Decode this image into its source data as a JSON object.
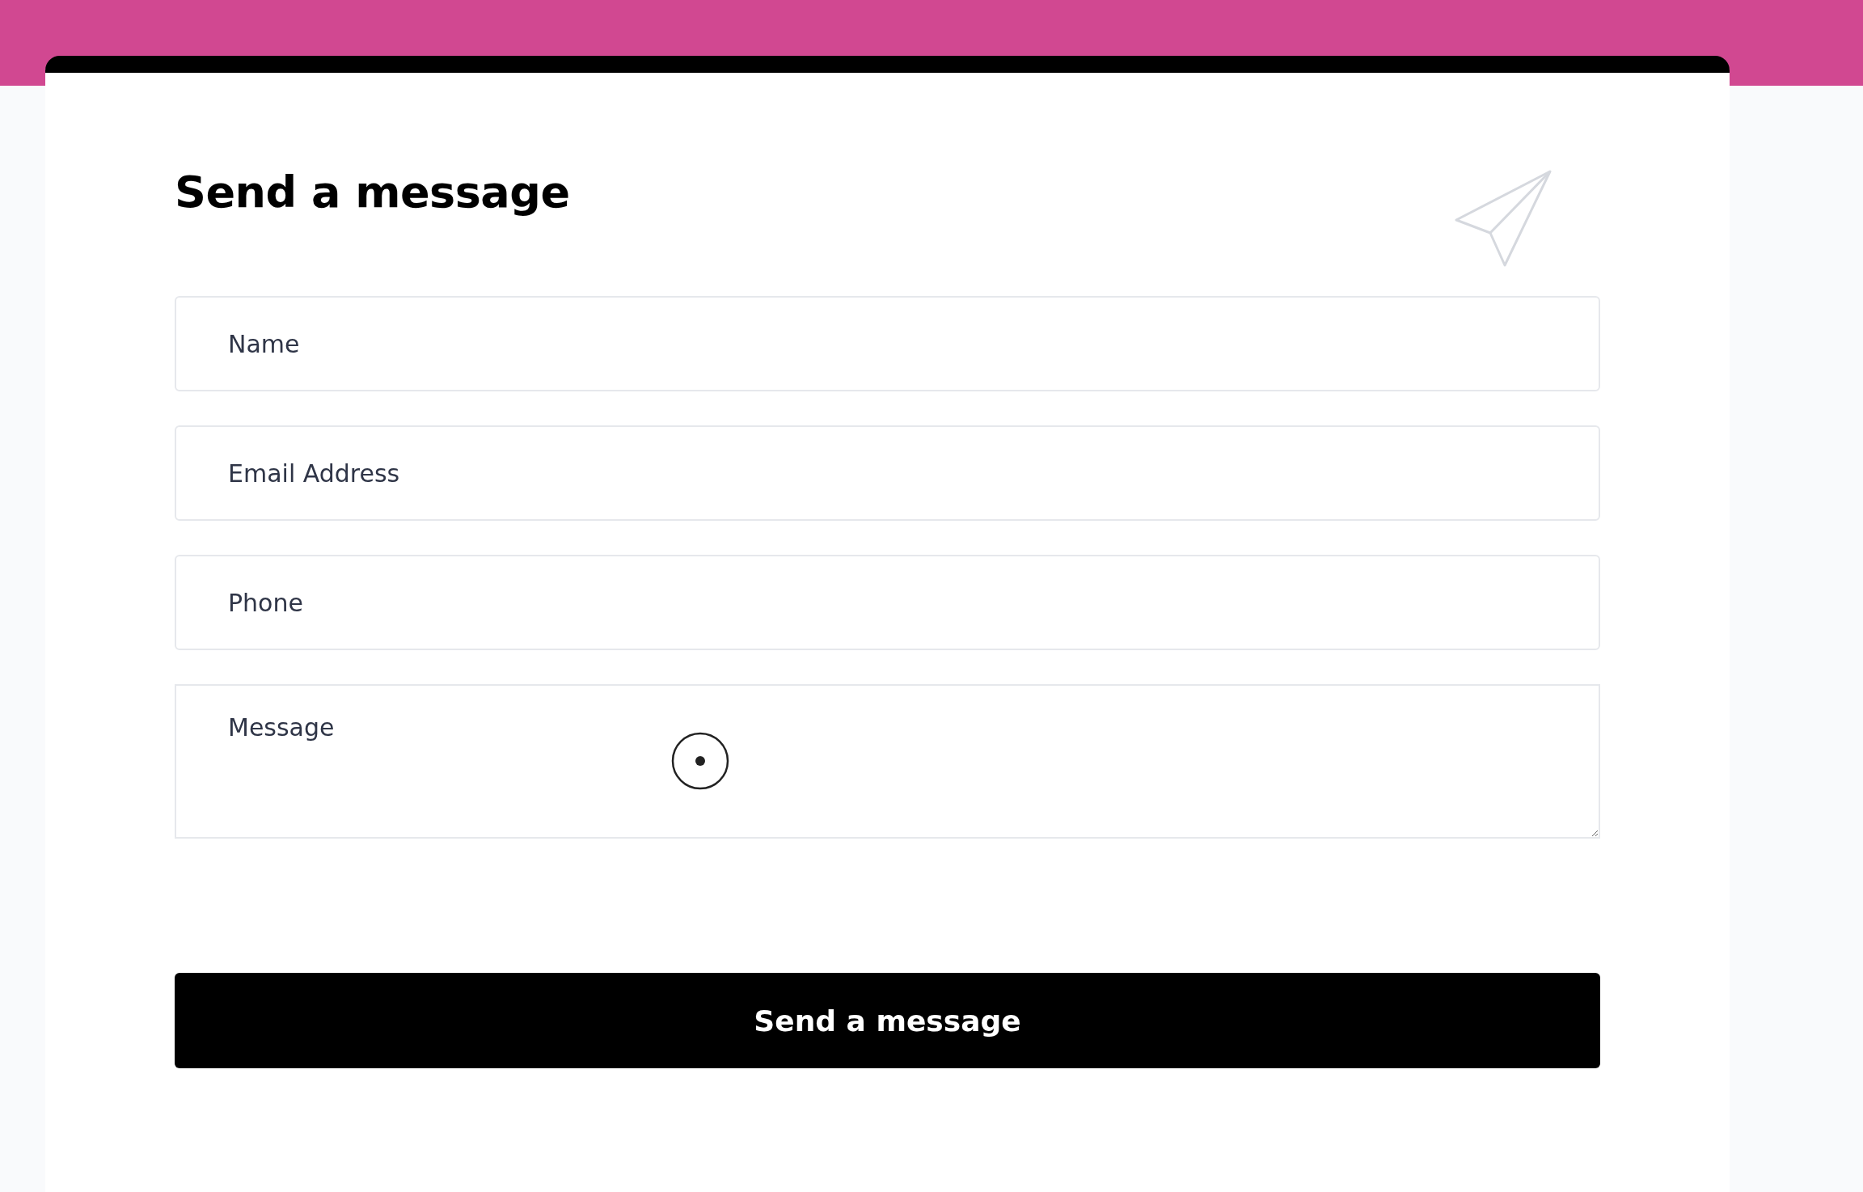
{
  "form": {
    "title": "Send a message",
    "fields": [
      {
        "kind": "input",
        "placeholder": "Name"
      },
      {
        "kind": "input",
        "placeholder": "Email Address"
      },
      {
        "kind": "input",
        "placeholder": "Phone"
      },
      {
        "kind": "textarea",
        "placeholder": "Message"
      }
    ],
    "submit": "Send a message"
  }
}
